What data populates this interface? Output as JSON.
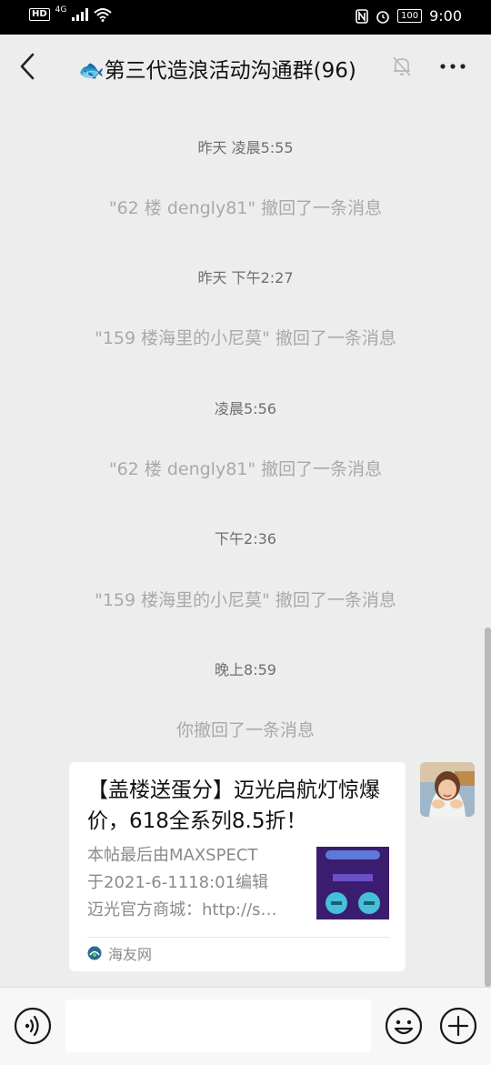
{
  "status_bar": {
    "left": [
      "HD",
      "4G"
    ],
    "battery": "100",
    "time": "9:00"
  },
  "header": {
    "title": "🐟第三代造浪活动沟通群(96)"
  },
  "messages": [
    {
      "kind": "time",
      "text": "昨天 凌晨5:55"
    },
    {
      "kind": "recall",
      "text": "\"62 楼 dengly81\" 撤回了一条消息"
    },
    {
      "kind": "time",
      "text": "昨天 下午2:27"
    },
    {
      "kind": "recall",
      "text": "\"159 楼海里的小尼莫\" 撤回了一条消息"
    },
    {
      "kind": "time",
      "text": "凌晨5:56"
    },
    {
      "kind": "recall",
      "text": "\"62 楼 dengly81\" 撤回了一条消息"
    },
    {
      "kind": "time",
      "text": "下午2:36"
    },
    {
      "kind": "recall",
      "text": "\"159 楼海里的小尼莫\" 撤回了一条消息"
    },
    {
      "kind": "time",
      "text": "晚上8:59"
    },
    {
      "kind": "recall",
      "text": "你撤回了一条消息"
    }
  ],
  "link_card": {
    "title": "【盖楼送蛋分】迈光启航灯惊爆价，618全系列8.5折！",
    "desc_lines": [
      "本帖最后由MAXSPECT",
      "于2021-6-1118:01编辑",
      "迈光官方商城：http://s…"
    ],
    "source": "海友网"
  },
  "icons": {
    "back": "chevron-left-icon",
    "mute": "bell-off-icon",
    "more": "more-dots-icon",
    "voice": "voice-icon",
    "emoji": "emoji-icon",
    "plus": "plus-icon"
  }
}
